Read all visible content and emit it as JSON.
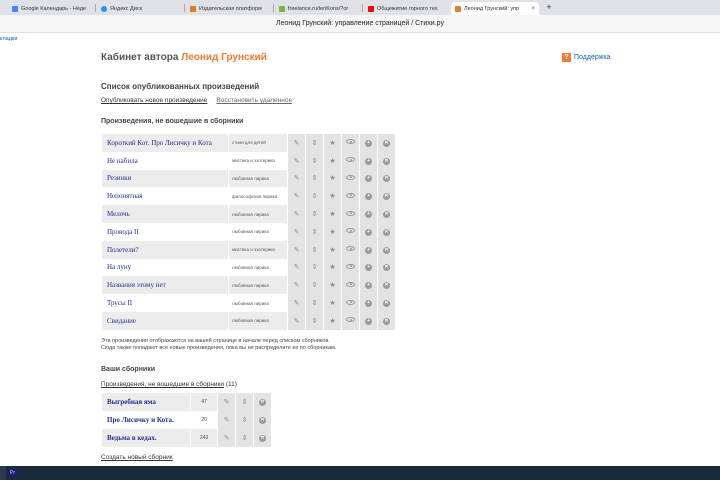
{
  "browser": {
    "tabs": [
      {
        "label": "Google Календарь - Неде",
        "fav_color": "#4285f4"
      },
      {
        "label": "Яндекс Диск",
        "fav_color": "#2196f3"
      },
      {
        "label": "Издательская платформ",
        "fav_color": "#e0782b"
      },
      {
        "label": "freelance.ru/teriKons/?or",
        "fav_color": "#7cb342"
      },
      {
        "label": "Общежитие горного тех",
        "fav_color": "#ff0000"
      },
      {
        "label": "Леонид Грунский: упр",
        "fav_color": "#ef7a33"
      }
    ],
    "window_title": "Леонид Грунский: управление страницей / Стихи.ру",
    "bookmarks_label": "кладки"
  },
  "header": {
    "prefix": "Кабинет автора",
    "author": "Леонид Грунский",
    "support_label": "Поддержка"
  },
  "published": {
    "title": "Список опубликованных произведений",
    "publish_new": "Опубликовать новое произведение",
    "restore_deleted": "Восстановить удаленное"
  },
  "uncollected": {
    "title": "Произведения, не вошедшие в сборники",
    "works": [
      {
        "title": "Короткий Кот. Про Лисичку и Кота",
        "genre": "стихи для детей"
      },
      {
        "title": "Не набила",
        "genre": "мистика и эзотерика"
      },
      {
        "title": "Резинки",
        "genre": "любовная лирика"
      },
      {
        "title": "Непонятная",
        "genre": "философская лирика"
      },
      {
        "title": "Мелочь",
        "genre": "любовная лирика"
      },
      {
        "title": "Провода II",
        "genre": "любовная лирика"
      },
      {
        "title": "Полетели?",
        "genre": "мистика и эзотерика"
      },
      {
        "title": "На луну",
        "genre": "любовная лирика"
      },
      {
        "title": "Названия этому нет",
        "genre": "любовная лирика"
      },
      {
        "title": "Трусы II",
        "genre": "любовная лирика"
      },
      {
        "title": "Свидание",
        "genre": "любовная лирика"
      }
    ],
    "note_line1": "Эти произведения отображаются на вашей странице в начале перед списком сборников.",
    "note_line2": "Сюда также попадают все новые произведения, пока вы не распределите их по сборникам."
  },
  "collections": {
    "title": "Ваши сборники",
    "uncollected_link": "Произведения, не вошедшие в сборники",
    "uncollected_count": "(11)",
    "items": [
      {
        "title": "Выгребная яма",
        "count": "47"
      },
      {
        "title": "Про Лисичку и Кота.",
        "count": "20"
      },
      {
        "title": "Ведьма в кедах.",
        "count": "243"
      }
    ],
    "create_label": "Создать новый сборник"
  },
  "icons": {
    "edit": "✎",
    "move": "⇕",
    "star": "★",
    "delete": "✕",
    "add": "+"
  },
  "taskbar": {
    "app_label": "Pr"
  }
}
